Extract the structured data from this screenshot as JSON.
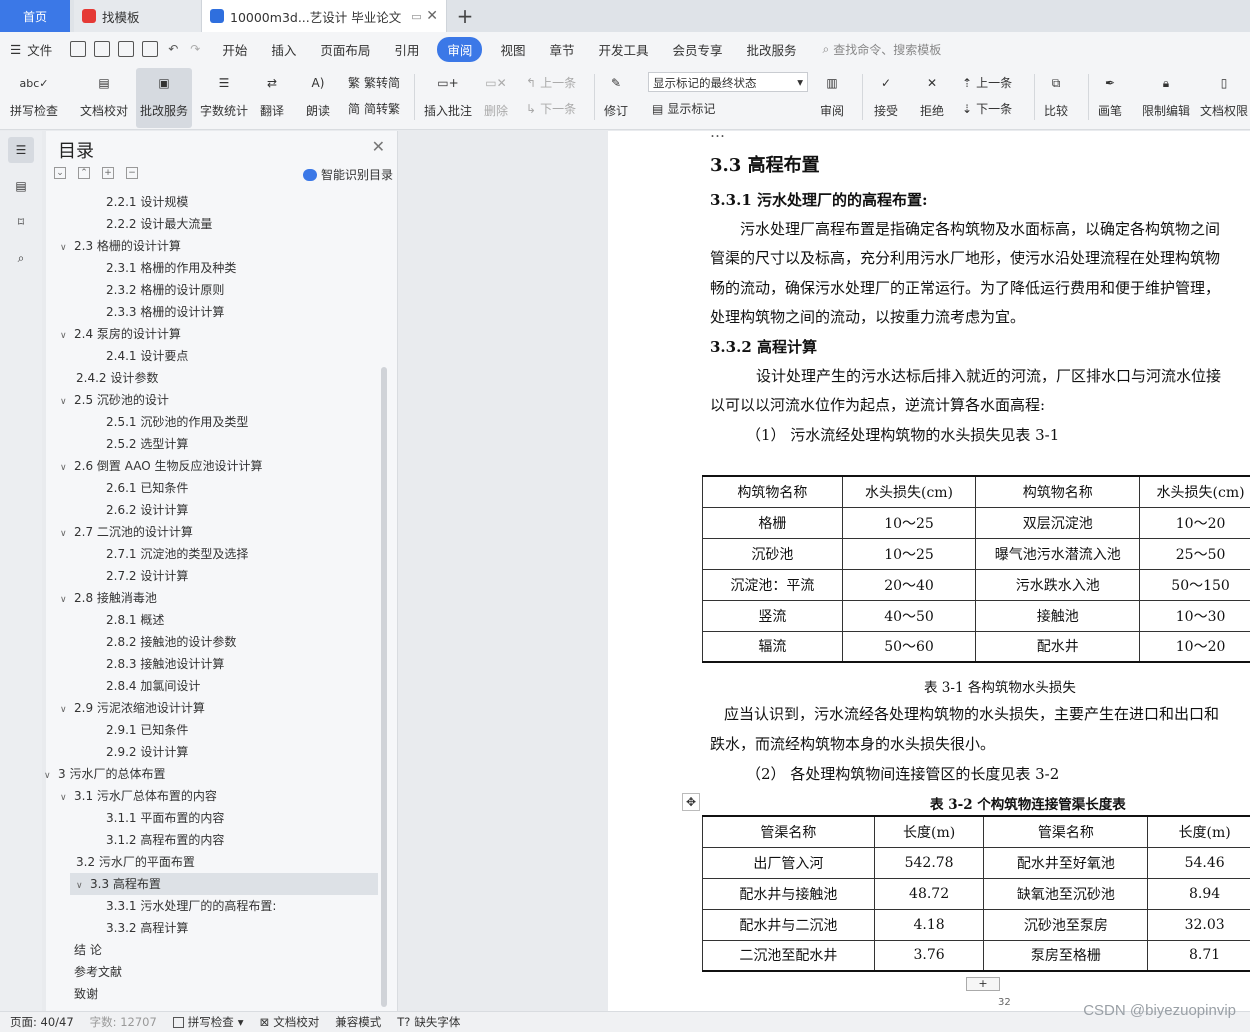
{
  "tabs": {
    "home": "首页",
    "zhaomoban": "找模板",
    "doc": "10000m3d...艺设计 毕业论文"
  },
  "menu": {
    "file": "文件",
    "items": [
      "开始",
      "插入",
      "页面布局",
      "引用",
      "审阅",
      "视图",
      "章节",
      "开发工具",
      "会员专享",
      "批改服务"
    ],
    "active": "审阅",
    "search": "查找命令、搜索模板"
  },
  "ribbon": {
    "spellcheck": "拼写检查",
    "proofread": "文档校对",
    "correction": "批改服务",
    "wordcount": "字数统计",
    "translate": "翻译",
    "read": "朗读",
    "trad": "繁转简",
    "simp": "简转繁",
    "insert_comment": "插入批注",
    "delete": "删除",
    "prev": "上一条",
    "next": "下一条",
    "revise": "修订",
    "markup_select": "显示标记的最终状态",
    "show_markup": "显示标记",
    "review": "审阅",
    "accept": "接受",
    "reject": "拒绝",
    "prev2": "上一条",
    "next2": "下一条",
    "compare": "比较",
    "pen": "画笔",
    "restrict": "限制编辑",
    "doc_perm": "文档权限"
  },
  "toc": {
    "title": "目录",
    "smart": "智能识别目录",
    "items": [
      {
        "text": "2.2.1  设计规模",
        "level": 3
      },
      {
        "text": "2.2.2  设计最大流量",
        "level": 3
      },
      {
        "text": "2.3  格栅的设计计算",
        "level": 2,
        "arrow": true
      },
      {
        "text": "2.3.1 格栅的作用及种类",
        "level": 3
      },
      {
        "text": "2.3.2 格栅的设计原则",
        "level": 3
      },
      {
        "text": "2.3.3  格栅的设计计算",
        "level": 3
      },
      {
        "text": "2.4  泵房的设计计算",
        "level": 2,
        "arrow": true
      },
      {
        "text": "2.4.1  设计要点",
        "level": 3
      },
      {
        "text": "2.4.2  设计参数",
        "level": 2
      },
      {
        "text": "2.5 沉砂池的设计",
        "level": 2,
        "arrow": true
      },
      {
        "text": "2.5.1 沉砂池的作用及类型",
        "level": 3
      },
      {
        "text": "2.5.2  选型计算",
        "level": 3
      },
      {
        "text": "2.6  倒置  AAO 生物反应池设计计算",
        "level": 2,
        "arrow": true
      },
      {
        "text": "2.6.1  已知条件",
        "level": 3
      },
      {
        "text": "2.6.2  设计计算",
        "level": 3
      },
      {
        "text": "2.7  二沉池的设计计算",
        "level": 2,
        "arrow": true
      },
      {
        "text": "2.7.1 沉淀池的类型及选择",
        "level": 3
      },
      {
        "text": "2.7.2 设计计算",
        "level": 3
      },
      {
        "text": "2.8  接触消毒池",
        "level": 2,
        "arrow": true
      },
      {
        "text": "2.8.1 概述",
        "level": 3
      },
      {
        "text": "2.8.2 接触池的设计参数",
        "level": 3
      },
      {
        "text": "2.8.3  接触池设计计算",
        "level": 3
      },
      {
        "text": "2.8.4  加氯间设计",
        "level": 3
      },
      {
        "text": "2.9  污泥浓缩池设计计算",
        "level": 2,
        "arrow": true
      },
      {
        "text": "2.9.1  已知条件",
        "level": 3
      },
      {
        "text": "2.9.2 设计计算",
        "level": 3
      },
      {
        "text": "3  污水厂的总体布置",
        "level": 1,
        "arrow": true
      },
      {
        "text": "3.1  污水厂总体布置的内容",
        "level": 2,
        "arrow": true
      },
      {
        "text": "3.1.1  平面布置的内容",
        "level": 3
      },
      {
        "text": "3.1.2 高程布置的内容",
        "level": 3
      },
      {
        "text": "3.2  污水厂的平面布置",
        "level": 2
      },
      {
        "text": "3.3  高程布置",
        "level": 2,
        "arrow": true,
        "selected": true
      },
      {
        "text": "3.3.1 污水处理厂的的高程布置:",
        "level": 3
      },
      {
        "text": "3.3.2 高程计算",
        "level": 3
      },
      {
        "text": "结  论",
        "level": 0
      },
      {
        "text": "参考文献",
        "level": 0
      },
      {
        "text": "致谢",
        "level": 0
      }
    ]
  },
  "doc": {
    "h33": "3.3  高程布置",
    "h331": "3.3.1 污水处理厂的的高程布置:",
    "p1": [
      "污水处理厂高程布置是指确定各构筑物及水面标高，以确定各构筑物之间",
      "管渠的尺寸以及标高，充分利用污水厂地形，使污水沿处理流程在处理构筑物",
      "畅的流动，确保污水处理厂的正常运行。为了降低运行费用和便于维护管理，",
      "处理构筑物之间的流动，以按重力流考虑为宜。"
    ],
    "h332": "3.3.2 高程计算",
    "p2": [
      "设计处理产生的污水达标后排入就近的河流，厂区排水口与河流水位接",
      "以可以以河流水位作为起点，逆流计算各水面高程:"
    ],
    "item1": "（1） 污水流经处理构筑物的水头损失见表 3-1",
    "table1": {
      "header": [
        "构筑物名称",
        "水头损失(cm)",
        "构筑物名称",
        "水头损失(cm)"
      ],
      "rows": [
        [
          "格栅",
          "10～25",
          "双层沉淀池",
          "10～20"
        ],
        [
          "沉砂池",
          "10～25",
          "曝气池污水潜流入池",
          "25～50"
        ],
        [
          "沉淀池：平流",
          "20～40",
          "污水跌水入池",
          "50～150"
        ],
        [
          "竖流",
          "40～50",
          "接触池",
          "10～30"
        ],
        [
          "辐流",
          "50～60",
          "配水井",
          "10～20"
        ]
      ]
    },
    "caption1": "表 3-1 各构筑物水头损失",
    "p3": [
      "应当认识到，污水流经各处理构筑物的水头损失，主要产生在进口和出口和",
      "跌水，而流经构筑物本身的水头损失很小。"
    ],
    "item2": "（2） 各处理构筑物间连接管区的长度见表 3-2",
    "caption2": "表 3-2 个构筑物连接管渠长度表",
    "table2": {
      "header": [
        "管渠名称",
        "长度(m)",
        "管渠名称",
        "长度(m)"
      ],
      "rows": [
        [
          "出厂管入河",
          "542.78",
          "配水井至好氧池",
          "54.46"
        ],
        [
          "配水井与接触池",
          "48.72",
          "缺氧池至沉砂池",
          "8.94"
        ],
        [
          "配水井与二沉池",
          "4.18",
          "沉砂池至泵房",
          "32.03"
        ],
        [
          "二沉池至配水井",
          "3.76",
          "泵房至格栅",
          "8.71"
        ]
      ]
    },
    "page_num": "32"
  },
  "status": {
    "page": "页面: 40/47",
    "words": "字数: 12707",
    "spell": "拼写检查",
    "proof": "文档校对",
    "compat": "兼容模式",
    "missing_font": "缺失字体"
  },
  "watermark": "CSDN @biyezuopinvip"
}
